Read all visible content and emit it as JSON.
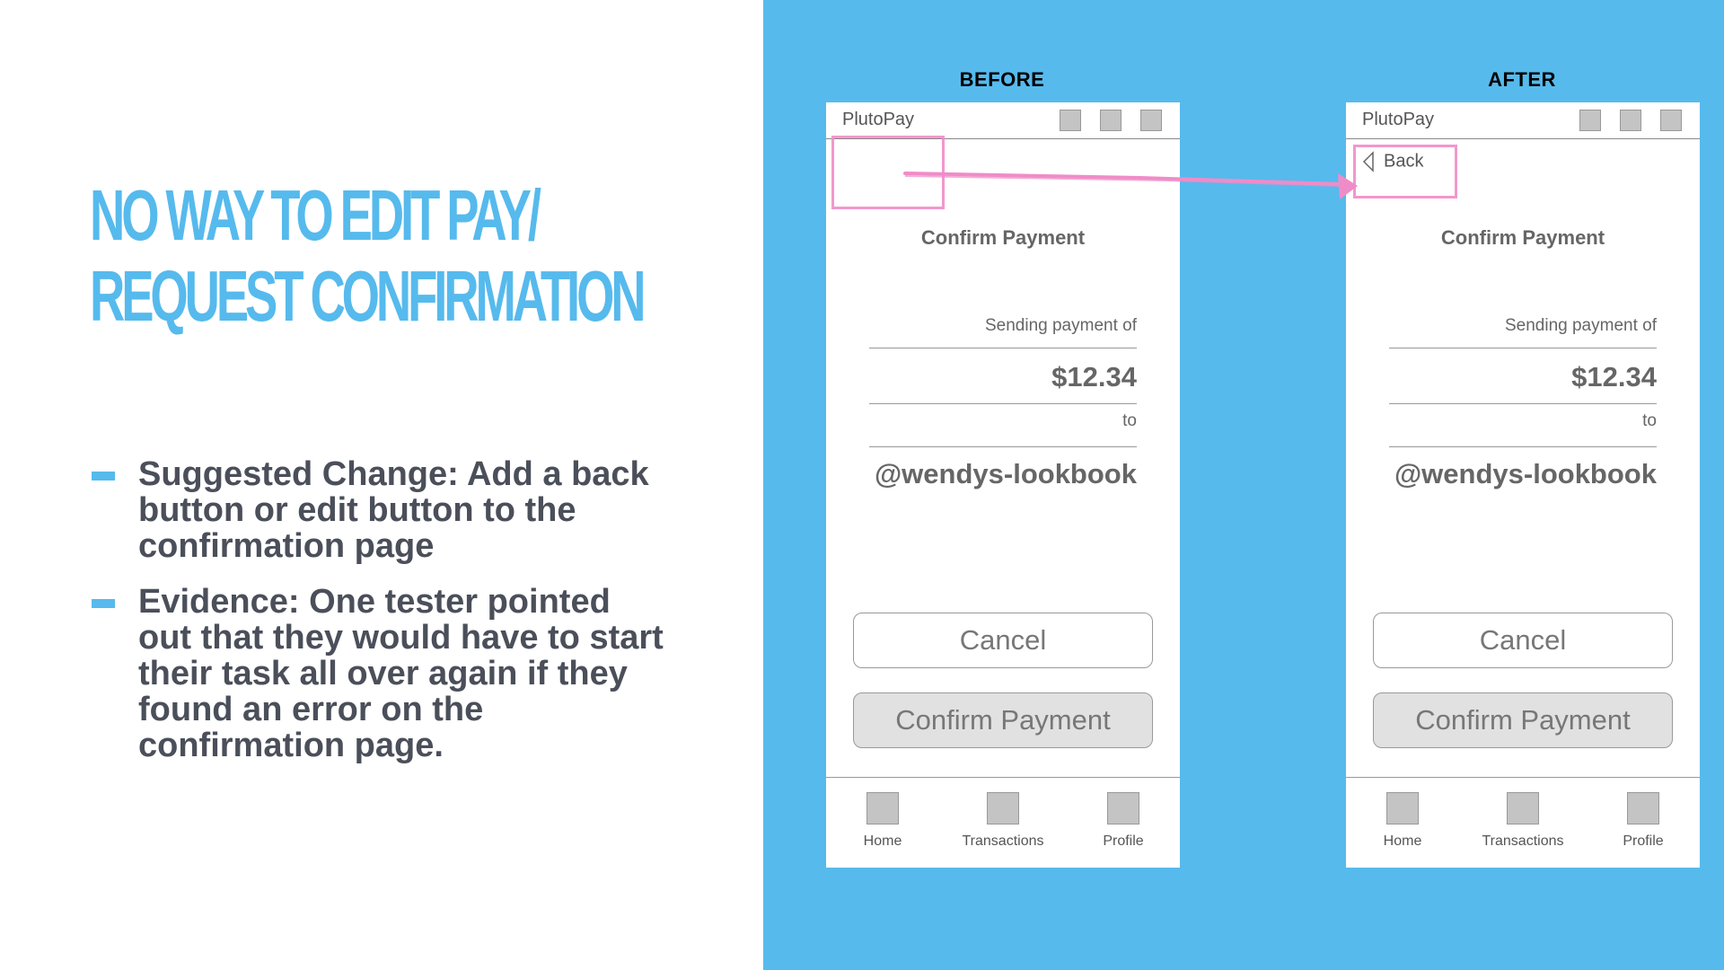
{
  "slide": {
    "title_lines": [
      "NO WAY TO EDIT PAY/",
      "REQUEST CONFIRMATION"
    ],
    "bullets": [
      "Suggested Change: Add a back button or edit button to the confirmation page",
      "Evidence: One tester pointed out that they would have to start their task all over again if they found an error on the confirmation page."
    ]
  },
  "colors": {
    "accent": "#56baed",
    "highlight": "#ef8cc8",
    "text": "#4a4f5a"
  },
  "before": {
    "label": "BEFORE",
    "app_name": "PlutoPay",
    "screen_title": "Confirm Payment",
    "sending_label": "Sending payment of",
    "amount": "$12.34",
    "to_label": "to",
    "recipient": "@wendys-lookbook",
    "cancel_label": "Cancel",
    "confirm_label": "Confirm Payment",
    "tabs": [
      "Home",
      "Transactions",
      "Profile"
    ]
  },
  "after": {
    "label": "AFTER",
    "app_name": "PlutoPay",
    "back_label": "Back",
    "screen_title": "Confirm Payment",
    "sending_label": "Sending payment of",
    "amount": "$12.34",
    "to_label": "to",
    "recipient": "@wendys-lookbook",
    "cancel_label": "Cancel",
    "confirm_label": "Confirm Payment",
    "tabs": [
      "Home",
      "Transactions",
      "Profile"
    ]
  },
  "icons": {
    "header_squares": "placeholder-square-icon",
    "back": "chevron-left-icon",
    "tabs": "placeholder-square-icon"
  }
}
